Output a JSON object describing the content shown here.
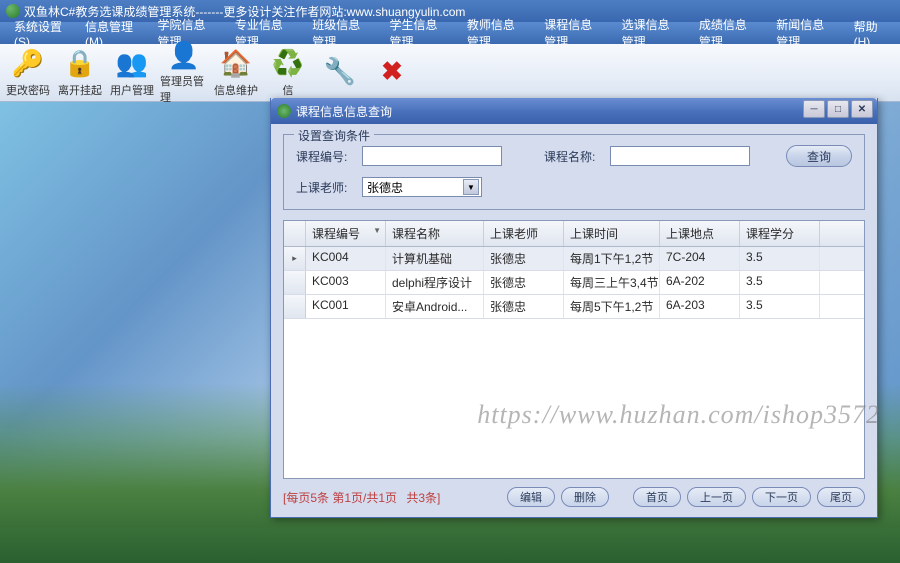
{
  "app": {
    "title": "双鱼林C#教务选课成绩管理系统-------更多设计关注作者网站:www.shuangyulin.com"
  },
  "menubar": {
    "items": [
      "系统设置(S)",
      "信息管理(M)",
      "学院信息管理",
      "专业信息管理",
      "班级信息管理",
      "学生信息管理",
      "教师信息管理",
      "课程信息管理",
      "选课信息管理",
      "成绩信息管理",
      "新闻信息管理",
      "帮助(H)"
    ]
  },
  "toolbar": {
    "items": [
      {
        "label": "更改密码",
        "icon": "🔑"
      },
      {
        "label": "离开挂起",
        "icon": "🔒"
      },
      {
        "label": "用户管理",
        "icon": "👥"
      },
      {
        "label": "管理员管理",
        "icon": "👤"
      },
      {
        "label": "信息维护",
        "icon": "🏠"
      },
      {
        "label": "信",
        "icon": "♻️"
      },
      {
        "label": "",
        "icon": "🔧"
      },
      {
        "label": "",
        "icon": "✖"
      }
    ]
  },
  "dialog": {
    "title": "课程信息信息查询",
    "fieldset_title": "设置查询条件",
    "labels": {
      "course_id": "课程编号:",
      "course_name": "课程名称:",
      "teacher": "上课老师:"
    },
    "inputs": {
      "course_id": "",
      "course_name": "",
      "teacher": "张德忠"
    },
    "buttons": {
      "query": "查询",
      "edit": "编辑",
      "delete": "删除",
      "first": "首页",
      "prev": "上一页",
      "next": "下一页",
      "last": "尾页"
    }
  },
  "grid": {
    "columns": [
      "课程编号",
      "课程名称",
      "上课老师",
      "上课时间",
      "上课地点",
      "课程学分"
    ],
    "rows": [
      {
        "id": "KC004",
        "name": "计算机基础",
        "teacher": "张德忠",
        "time": "每周1下午1,2节",
        "place": "7C-204",
        "credit": "3.5",
        "selected": true
      },
      {
        "id": "KC003",
        "name": "delphi程序设计",
        "teacher": "张德忠",
        "time": "每周三上午3,4节",
        "place": "6A-202",
        "credit": "3.5",
        "selected": false
      },
      {
        "id": "KC001",
        "name": "安卓Android...",
        "teacher": "张德忠",
        "time": "每周5下午1,2节",
        "place": "6A-203",
        "credit": "3.5",
        "selected": false
      }
    ]
  },
  "pager": {
    "info1": "[每页5条 第1页/共1页",
    "info2": "共3条]"
  },
  "watermark": "https://www.huzhan.com/ishop3572"
}
